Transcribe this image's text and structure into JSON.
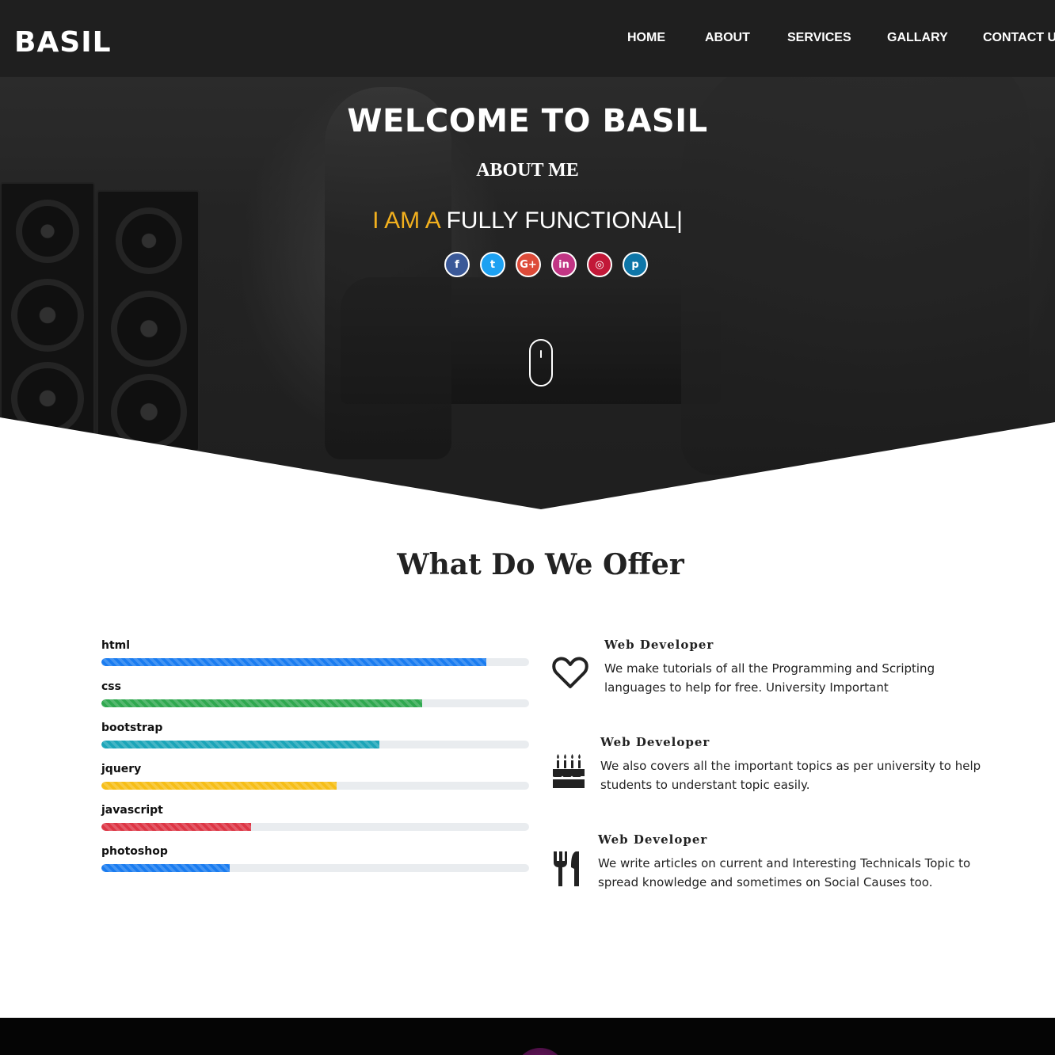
{
  "brand": {
    "logo": "BASIL"
  },
  "nav": {
    "items": [
      {
        "label": "HOME"
      },
      {
        "label": "ABOUT"
      },
      {
        "label": "SERVICES"
      },
      {
        "label": "GALLARY"
      },
      {
        "label": "CONTACT U"
      }
    ]
  },
  "hero": {
    "title": "WELCOME TO BASIL",
    "subtitle": "ABOUT ME",
    "typed_prefix": "I AM A ",
    "typed_text": "FULLY FUNCTIONAL|",
    "accent_color": "#f2b01e",
    "socials": [
      {
        "icon": "facebook-icon",
        "glyph": "f",
        "color": "#3b5998"
      },
      {
        "icon": "twitter-icon",
        "glyph": "t",
        "color": "#1da1f2"
      },
      {
        "icon": "google-plus-icon",
        "glyph": "G+",
        "color": "#dd4b39"
      },
      {
        "icon": "linkedin-icon",
        "glyph": "in",
        "color": "#c13584"
      },
      {
        "icon": "instagram-icon",
        "glyph": "◎",
        "color": "#c21838"
      },
      {
        "icon": "pinterest-icon",
        "glyph": "p",
        "color": "#0e76a8"
      }
    ],
    "scroll_icon": "mouse-scroll-icon"
  },
  "offer": {
    "title": "What Do We Offer",
    "skills": [
      {
        "label": "html",
        "percent": 90,
        "color": "#1a7cf0"
      },
      {
        "label": "css",
        "percent": 75,
        "color": "#2fa84f"
      },
      {
        "label": "bootstrap",
        "percent": 65,
        "color": "#1ba5b8"
      },
      {
        "label": "jquery",
        "percent": 55,
        "color": "#f6be17"
      },
      {
        "label": "javascript",
        "percent": 35,
        "color": "#dd3645"
      },
      {
        "label": "photoshop",
        "percent": 30,
        "color": "#1a7cf0"
      }
    ],
    "services": [
      {
        "icon": "heart-icon",
        "title": "Web Developer",
        "text": "We make tutorials of all the Programming and Scripting languages to help for free. University Important"
      },
      {
        "icon": "birthday-cake-icon",
        "title": "Web Developer",
        "text": "We also covers all the important topics as per university to help students to understant topic easily."
      },
      {
        "icon": "utensils-icon",
        "title": "Web Developer",
        "text": "We write articles on current and Interesting Technicals Topic to spread knowledge and sometimes on Social Causes too."
      }
    ]
  }
}
